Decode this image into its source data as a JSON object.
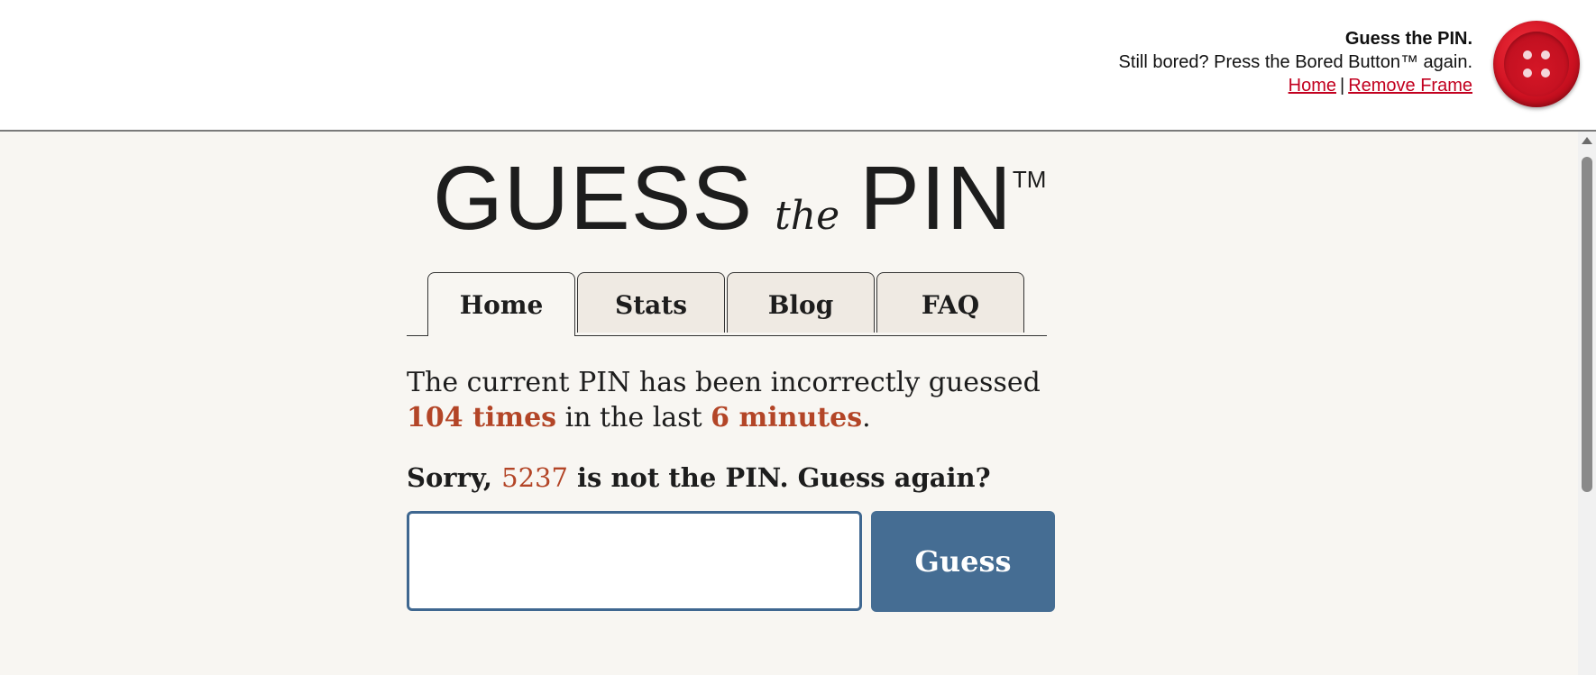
{
  "frame": {
    "title": "Guess the PIN.",
    "subtitle": "Still bored? Press the Bored Button™ again.",
    "home_link": "Home",
    "separator": "|",
    "remove_frame_link": "Remove Frame"
  },
  "logo": {
    "word1": "GUESS",
    "word2": "the",
    "word3": "PIN",
    "trademark": "TM"
  },
  "tabs": [
    {
      "label": "Home",
      "active": true
    },
    {
      "label": "Stats",
      "active": false
    },
    {
      "label": "Blog",
      "active": false
    },
    {
      "label": "FAQ",
      "active": false
    }
  ],
  "stats": {
    "line1": "The current PIN has been incorrectly guessed",
    "count": "104 times",
    "middle": " in the last ",
    "duration": "6 minutes",
    "end": "."
  },
  "result": {
    "prefix": "Sorry, ",
    "pin": "5237",
    "suffix": " is not the PIN. Guess again?"
  },
  "guess": {
    "input_value": "",
    "button_label": "Guess"
  },
  "colors": {
    "accent_red": "#b34527",
    "button_blue": "#456d93",
    "link_red": "#c2001f"
  }
}
